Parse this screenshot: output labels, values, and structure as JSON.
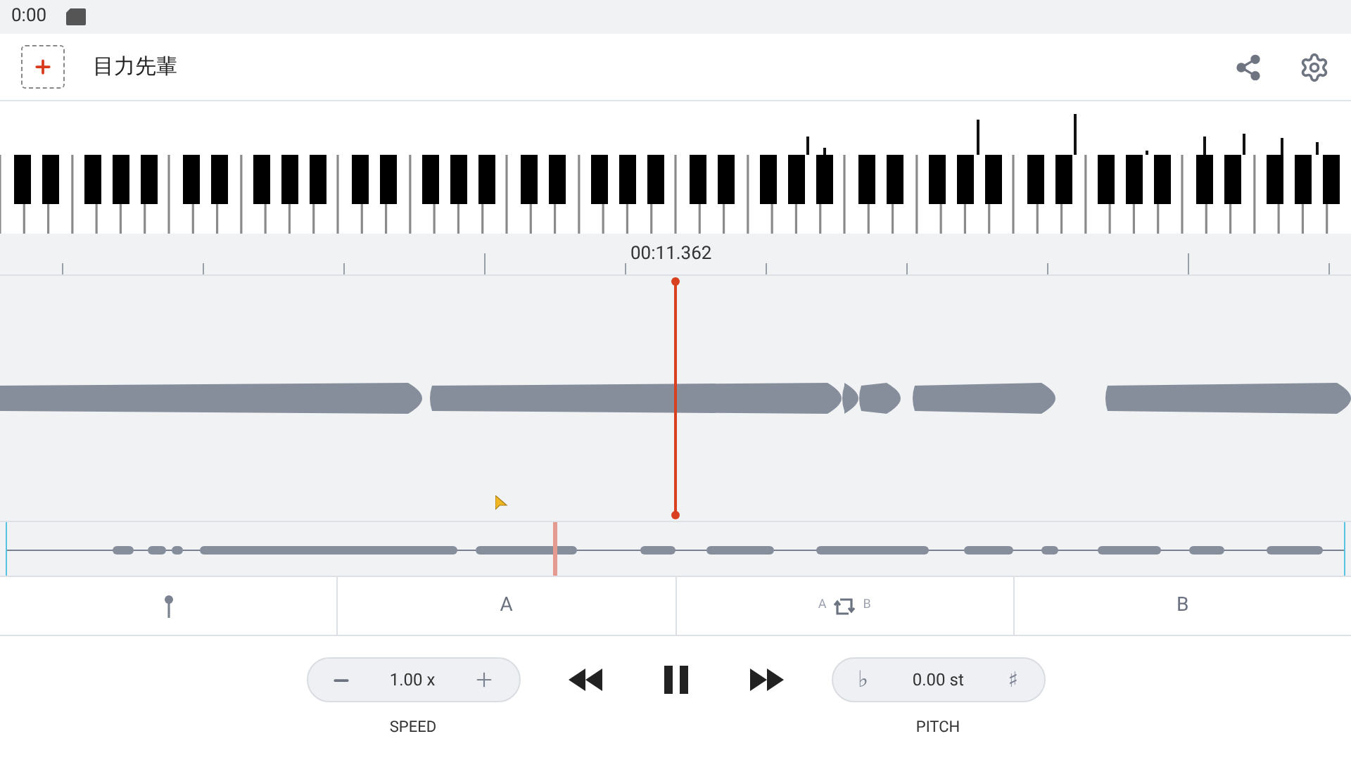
{
  "status_bar": {
    "time": "0:00"
  },
  "app_bar": {
    "title": "目力先輩"
  },
  "timeline": {
    "position": "00:11.362"
  },
  "playhead": {
    "level": 0.5
  },
  "overview": {
    "level": 0.41
  },
  "ab_tabs": [
    {
      "kind": "marker"
    },
    {
      "kind": "text",
      "label": "A"
    },
    {
      "kind": "loop",
      "left": "A",
      "right": "B"
    },
    {
      "kind": "text",
      "label": "B"
    }
  ],
  "speed": {
    "value": "1.00 x",
    "label": "SPEED"
  },
  "transport": {
    "playing": true
  },
  "pitch": {
    "flat": "♭",
    "value": "0.00 st",
    "sharp": "♯",
    "label": "PITCH"
  }
}
